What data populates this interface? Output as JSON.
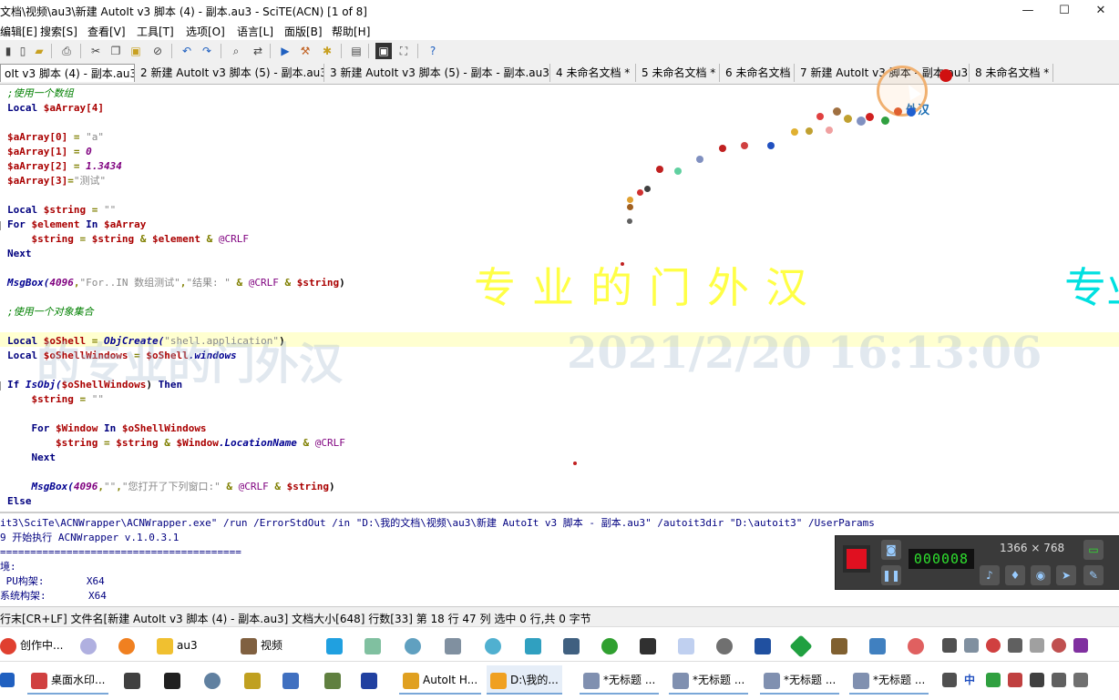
{
  "window": {
    "title": "文档\\视频\\au3\\新建 AutoIt v3 脚本 (4) - 副本.au3 - SciTE(ACN) [1 of 8]",
    "minimize": "—",
    "maximize": "☐",
    "close": "✕"
  },
  "menu": [
    "编辑[E]",
    "搜索[S]",
    "查看[V]",
    "工具[T]",
    "选项[O]",
    "语言[L]",
    "面版[B]",
    "帮助[H]"
  ],
  "tabs": [
    "oIt v3 脚本 (4) - 副本.au3",
    "2 新建 AutoIt v3 脚本 (5) - 副本.au3",
    "3 新建 AutoIt v3 脚本 (5) - 副本 - 副本.au3",
    "4 未命名文档 *",
    "5 未命名文档 *",
    "6 未命名文档",
    "7 新建 AutoIt v3 脚本 - 副本.au3",
    "8 未命名文档 *"
  ],
  "code": {
    "c1": ";使用一个数组",
    "l2a": "Local ",
    "l2b": "$aArray[4]",
    "l4a": "$aArray[0]",
    "l4b": " = ",
    "l4c": "\"a\"",
    "l5a": "$aArray[1]",
    "l5b": " = ",
    "l5c": "0",
    "l6a": "$aArray[2]",
    "l6b": " = ",
    "l6c": "1.3434",
    "l7a": "$aArray[3]",
    "l7b": "=",
    "l7c": "\"测试\"",
    "l9a": "Local ",
    "l9b": "$string",
    "l9c": " = ",
    "l9d": "\"\"",
    "l10a": "For ",
    "l10b": "$element",
    "l10c": " In ",
    "l10d": "$aArray",
    "l11a": "    $string",
    "l11b": " = ",
    "l11c": "$string",
    "l11d": " & ",
    "l11e": "$element",
    "l11f": " & ",
    "l11g": "@CRLF",
    "l12": "Next",
    "l14a": "MsgBox(",
    "l14b": "4096",
    "l14c": ",",
    "l14d": "\"For..IN 数组测试\"",
    "l14e": ",",
    "l14f": "\"结果: \"",
    "l14g": " & ",
    "l14h": "@CRLF",
    "l14i": " & ",
    "l14j": "$string",
    "l14k": ")",
    "c2": ";使用一个对象集合",
    "l18a": "Local ",
    "l18b": "$oShell",
    "l18c": " = ",
    "l18d": "ObjCreate(",
    "l18e": "\"shell.application\"",
    "l18f": ")",
    "l19a": "Local ",
    "l19b": "$oShellWindows",
    "l19c": " = ",
    "l19d": "$oShell",
    "l19e": ".windows",
    "l21a": "If ",
    "l21b": "IsObj(",
    "l21c": "$oShellWindows",
    "l21d": ") ",
    "l21e": "Then",
    "l22a": "    $string",
    "l22b": " = ",
    "l22c": "\"\"",
    "l24a": "    For ",
    "l24b": "$Window",
    "l24c": " In ",
    "l24d": "$oShellWindows",
    "l25a": "        $string",
    "l25b": " = ",
    "l25c": "$string",
    "l25d": " & ",
    "l25e": "$Window",
    "l25f": ".LocationName",
    "l25g": " & ",
    "l25h": "@CRLF",
    "l26": "    Next",
    "l28a": "    MsgBox(",
    "l28b": "4096",
    "l28c": ",",
    "l28d": "\"\"",
    "l28e": ",",
    "l28f": "\"您打开了下列窗口:\"",
    "l28g": " & ",
    "l28h": "@CRLF",
    "l28i": " & ",
    "l28j": "$string",
    "l28k": ")",
    "l29": "Else"
  },
  "watermarks": {
    "seal_text": "专业的门外汉",
    "seal_partial": "专业",
    "ghost_text": "的专业的门外汉",
    "datetime": "2021/2/20 16:13:06",
    "cursor_label": "外汉"
  },
  "output": [
    "it3\\SciTe\\ACNWrapper\\ACNWrapper.exe\" /run /ErrorStdOut /in \"D:\\我的文档\\视频\\au3\\新建 AutoIt v3 脚本 - 副本.au3\" /autoit3dir \"D:\\autoit3\" /UserParams",
    "9 开始执行 ACNWrapper v.1.0.3.1",
    "========================================",
    "境:",
    " PU构架:       X64",
    "系统构架:       X64"
  ],
  "recorder": {
    "timer": "000008",
    "resolution": "1366 × 768"
  },
  "status": "行末[CR+LF] 文件名[新建 AutoIt v3 脚本 (4) - 副本.au3] 文档大小[648] 行数[33] 第 18 行 47 列 选中 0 行,共 0 字节",
  "taskbar_top": {
    "item1": "创作中...",
    "item2": "au3",
    "item3": "视频"
  },
  "taskbar_bottom": {
    "item1": "桌面水印...",
    "item2": "AutoIt H...",
    "item3": "D:\\我的...",
    "item4": "*无标题 ...",
    "item5": "*无标题 ...",
    "item6": "*无标题 ...",
    "item7": "*无标题 ...",
    "ime": "中"
  },
  "colors": {
    "seal_yellow": "#ffff33",
    "seal_cyan": "#00e0e0",
    "record_red": "#e01020",
    "timer_green": "#2fe02f"
  }
}
